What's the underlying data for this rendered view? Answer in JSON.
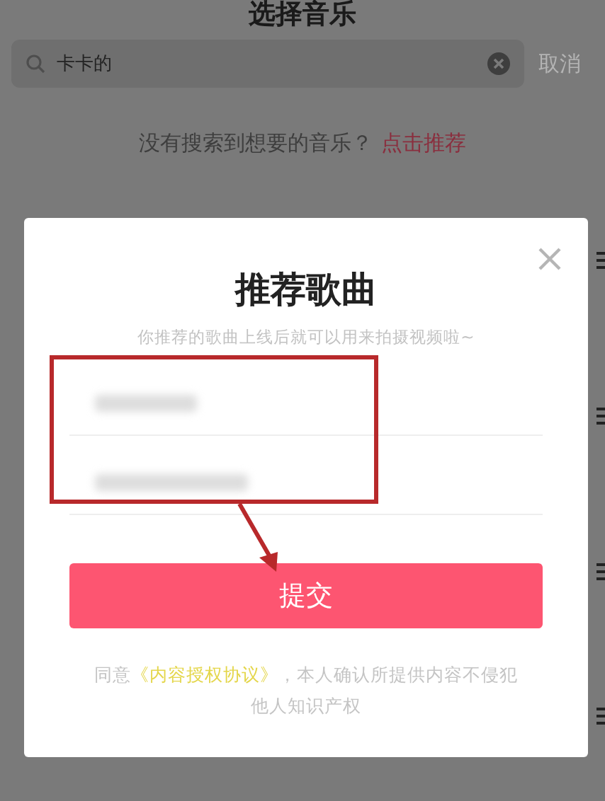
{
  "header": {
    "title": "选择音乐"
  },
  "search": {
    "value": "卡卡的",
    "cancel": "取消"
  },
  "empty_hint": {
    "text": "没有搜索到想要的音乐？",
    "link": "点击推荐"
  },
  "dialog": {
    "title": "推荐歌曲",
    "subtitle": "你推荐的歌曲上线后就可以用来拍摄视频啦~",
    "fields": [
      {
        "blurred": true
      },
      {
        "blurred": true
      }
    ],
    "submit": "提交",
    "agreement": {
      "prefix": "同意",
      "link": "《内容授权协议》",
      "suffix": "，本人确认所提供内容不侵犯他人知识产权"
    }
  }
}
